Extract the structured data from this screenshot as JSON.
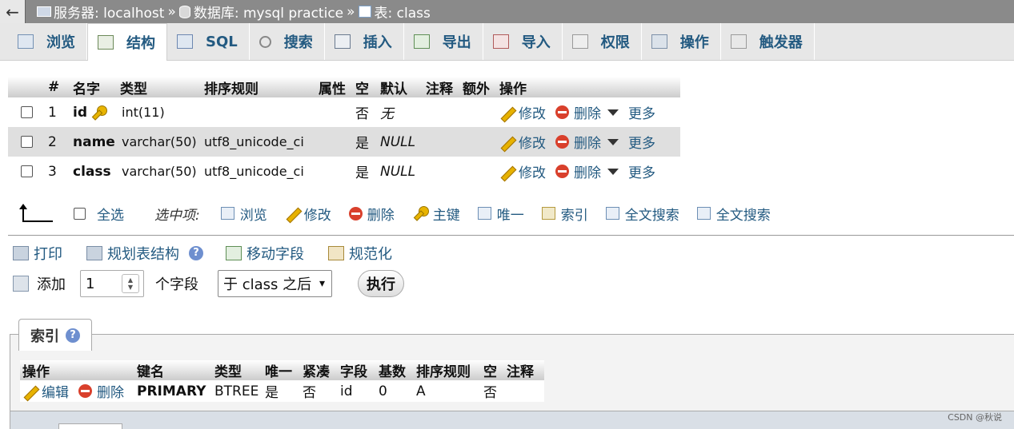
{
  "breadcrumb": {
    "back": "←",
    "server": "服务器: localhost",
    "sep": "»",
    "database": "数据库: mysql practice",
    "table": "表: class"
  },
  "tabs": [
    {
      "label": "浏览",
      "icon": "browse-icon"
    },
    {
      "label": "结构",
      "icon": "structure-icon",
      "active": true
    },
    {
      "label": "SQL",
      "icon": "sql-icon"
    },
    {
      "label": "搜索",
      "icon": "search-icon"
    },
    {
      "label": "插入",
      "icon": "insert-icon"
    },
    {
      "label": "导出",
      "icon": "export-icon"
    },
    {
      "label": "导入",
      "icon": "import-icon"
    },
    {
      "label": "权限",
      "icon": "privileges-icon"
    },
    {
      "label": "操作",
      "icon": "wrench-icon"
    },
    {
      "label": "触发器",
      "icon": "trigger-icon"
    }
  ],
  "structure": {
    "headers": [
      "#",
      "名字",
      "类型",
      "排序规则",
      "属性",
      "空",
      "默认",
      "注释",
      "额外",
      "操作"
    ],
    "rows": [
      {
        "num": "1",
        "name": "id",
        "type": "int(11)",
        "collation": "",
        "attr": "",
        "null": "否",
        "default": "无",
        "primary": true
      },
      {
        "num": "2",
        "name": "name",
        "type": "varchar(50)",
        "collation": "utf8_unicode_ci",
        "attr": "",
        "null": "是",
        "default": "NULL"
      },
      {
        "num": "3",
        "name": "class",
        "type": "varchar(50)",
        "collation": "utf8_unicode_ci",
        "attr": "",
        "null": "是",
        "default": "NULL"
      }
    ],
    "actions": {
      "edit": "修改",
      "drop": "删除",
      "more": "更多"
    }
  },
  "selection": {
    "check_all": "全选",
    "with_selected": "选中项:",
    "actions": [
      "浏览",
      "修改",
      "删除",
      "主键",
      "唯一",
      "索引",
      "全文搜索",
      "全文搜索"
    ]
  },
  "tools": {
    "print": "打印",
    "propose": "规划表结构",
    "move_columns": "移动字段",
    "normalize": "规范化"
  },
  "add_column": {
    "label": "添加",
    "count": "1",
    "unit": "个字段",
    "position": "于 class 之后",
    "go": "执行"
  },
  "indexes": {
    "tab_label": "索引",
    "headers": [
      "操作",
      "键名",
      "类型",
      "唯一",
      "紧凑",
      "字段",
      "基数",
      "排序规则",
      "空",
      "注释"
    ],
    "row": {
      "edit": "编辑",
      "drop": "删除",
      "keyname": "PRIMARY",
      "type": "BTREE",
      "unique": "是",
      "packed": "否",
      "column": "id",
      "cardinality": "0",
      "collation": "A",
      "null": "否",
      "comment": ""
    }
  },
  "watermark": "CSDN @秋说"
}
